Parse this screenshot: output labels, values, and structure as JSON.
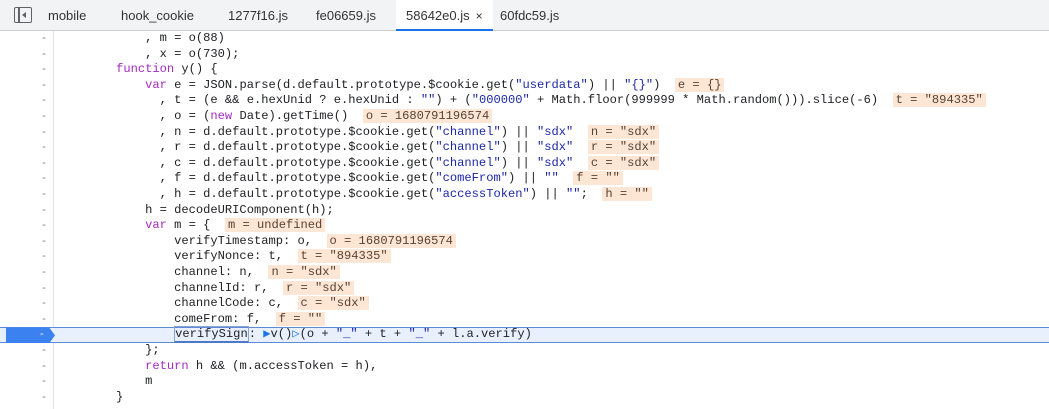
{
  "tabs": [
    {
      "label": "mobile"
    },
    {
      "label": "hook_cookie"
    },
    {
      "label": "1277f16.js"
    },
    {
      "label": "fe06659.js"
    },
    {
      "label": "58642e0.js",
      "active": true,
      "close": "×"
    },
    {
      "label": "60fdc59.js"
    }
  ],
  "gutter": {
    "mark": "-"
  },
  "code": {
    "l1": "            , m = o(88)",
    "l2": "            , x = o(730);",
    "l3_kw": "function",
    "l3_rest": " y() {",
    "l4_kw": "var",
    "l4_a": " e = JSON.parse(d.default.prototype.$cookie.get(",
    "l4_s1": "\"userdata\"",
    "l4_b": ") || ",
    "l4_s2": "\"{}\"",
    "l4_c": ")",
    "l4_hl": "e = {}",
    "l5_a": "              , t = (e && e.hexUnid ? e.hexUnid : ",
    "l5_s1": "\"\"",
    "l5_b": ") + (",
    "l5_s2": "\"000000\"",
    "l5_c": " + Math.floor(",
    "l5_n1": "999999",
    "l5_d": " * Math.random())).slice(",
    "l5_n2": "-6",
    "l5_e": ")",
    "l5_hl": "t = \"894335\"",
    "l6_a": "              , o = (",
    "l6_kw": "new",
    "l6_b": " Date).getTime()",
    "l6_hl": "o = 1680791196574",
    "l7_a": "              , n = d.default.prototype.$cookie.get(",
    "l7_s1": "\"channel\"",
    "l7_b": ") || ",
    "l7_s2": "\"sdx\"",
    "l7_hl": "n = \"sdx\"",
    "l8_a": "              , r = d.default.prototype.$cookie.get(",
    "l8_s1": "\"channel\"",
    "l8_b": ") || ",
    "l8_s2": "\"sdx\"",
    "l8_hl": "r = \"sdx\"",
    "l9_a": "              , c = d.default.prototype.$cookie.get(",
    "l9_s1": "\"channel\"",
    "l9_b": ") || ",
    "l9_s2": "\"sdx\"",
    "l9_hl": "c = \"sdx\"",
    "l10_a": "              , f = d.default.prototype.$cookie.get(",
    "l10_s1": "\"comeFrom\"",
    "l10_b": ") || ",
    "l10_s2": "\"\"",
    "l10_hl": "f = \"\"",
    "l11_a": "              , h = d.default.prototype.$cookie.get(",
    "l11_s1": "\"accessToken\"",
    "l11_b": ") || ",
    "l11_s2": "\"\"",
    "l11_c": ";",
    "l11_hl": "h = \"\"",
    "l12": "            h = decodeURIComponent(h);",
    "l13_kw": "var",
    "l13_a": " m = {",
    "l13_hl": "m = undefined",
    "l14_a": "                verifyTimestamp: o,",
    "l14_hl": "o = 1680791196574",
    "l15_a": "                verifyNonce: t,",
    "l15_hl": "t = \"894335\"",
    "l16_a": "                channel: n,",
    "l16_hl": "n = \"sdx\"",
    "l17_a": "                channelId: r,",
    "l17_hl": "r = \"sdx\"",
    "l18_a": "                channelCode: c,",
    "l18_hl": "c = \"sdx\"",
    "l19_a": "                comeFrom: f,",
    "l19_hl": "f = \"\"",
    "l20_sel": "verifySign",
    "l20_a": ": ",
    "l20_fn": "v()",
    "l20_b": "(o + ",
    "l20_s1": "\"_\"",
    "l20_c": " + t + ",
    "l20_s2": "\"_\"",
    "l20_d": " + l.a.verify)",
    "l21": "            };",
    "l22_kw": "return",
    "l22_a": " h && (m.accessToken = h),",
    "l23": "            m",
    "l24": "        }"
  }
}
